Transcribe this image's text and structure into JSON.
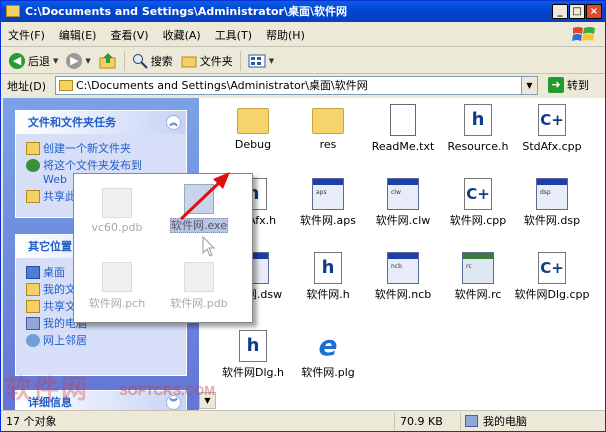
{
  "window": {
    "title": "C:\\Documents and Settings\\Administrator\\桌面\\软件网"
  },
  "title_buttons": {
    "minimize": "_",
    "maximize": "□",
    "close": "×"
  },
  "menu": [
    "文件(F)",
    "编辑(E)",
    "查看(V)",
    "收藏(A)",
    "工具(T)",
    "帮助(H)"
  ],
  "toolbar": {
    "back": "后退",
    "search": "搜索",
    "folders": "文件夹"
  },
  "address": {
    "label": "地址(D)",
    "value": "C:\\Documents and Settings\\Administrator\\桌面\\软件网",
    "go": "转到"
  },
  "tasks": {
    "file_tasks_title": "文件和文件夹任务",
    "file_tasks": [
      "创建一个新文件夹",
      "将这个文件夹发布到",
      "Web",
      "共享此文件夹"
    ],
    "other_title": "其它位置",
    "other": [
      "桌面",
      "我的文档",
      "共享文档",
      "我的电脑",
      "网上邻居"
    ],
    "details_title": "详细信息"
  },
  "files": [
    {
      "name": "Debug",
      "icon": "folder-icon"
    },
    {
      "name": "res",
      "icon": "folder-icon"
    },
    {
      "name": "ReadMe.txt",
      "icon": "text-file-icon"
    },
    {
      "name": "Resource.h",
      "icon": "h-file-icon"
    },
    {
      "name": "StdAfx.cpp",
      "icon": "cpp-file-icon"
    },
    {
      "name": "StdAfx.h",
      "icon": "h-file-icon"
    },
    {
      "name": "软件网.aps",
      "icon": "app-file-icon"
    },
    {
      "name": "软件网.clw",
      "icon": "app-file-icon"
    },
    {
      "name": "软件网.cpp",
      "icon": "cpp-file-icon"
    },
    {
      "name": "软件网.dsp",
      "icon": "dsp-file-icon"
    },
    {
      "name": "软件网.dsw",
      "icon": "app-file-icon"
    },
    {
      "name": "软件网.h",
      "icon": "h-file-icon"
    },
    {
      "name": "软件网.ncb",
      "icon": "app-file-icon"
    },
    {
      "name": "软件网.rc",
      "icon": "rc-file-icon"
    },
    {
      "name": "软件网Dlg.cpp",
      "icon": "cpp-file-icon"
    },
    {
      "name": "软件网Dlg.h",
      "icon": "h-file-icon"
    },
    {
      "name": "软件网.plg",
      "icon": "ie-file-icon"
    }
  ],
  "popup_files": [
    {
      "name": "vc60.pdb",
      "selected": false
    },
    {
      "name": "软件网.exe",
      "selected": true
    },
    {
      "name": "软件网.pch",
      "selected": false
    },
    {
      "name": "软件网.pdb",
      "selected": false
    }
  ],
  "status": {
    "count": "17 个对象",
    "size": "70.9 KB",
    "location": "我的电脑"
  },
  "watermark": {
    "main": "软件网",
    "site": "SOFTCRS.COM"
  },
  "colors": {
    "titlebar": "#0a5fe0",
    "task_header_text": "#215dc6",
    "arrow": "#e01010"
  }
}
